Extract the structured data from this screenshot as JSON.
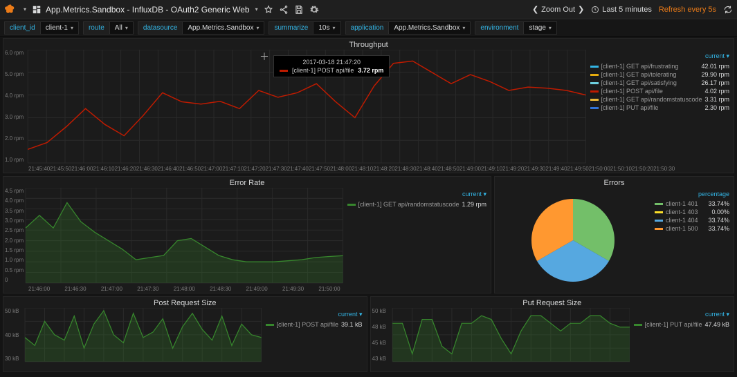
{
  "topbar": {
    "title": "App.Metrics.Sandbox - InfluxDB - OAuth2 Generic Web",
    "zoom_out": "Zoom Out",
    "timerange": "Last 5 minutes",
    "refresh": "Refresh every 5s"
  },
  "vars": [
    {
      "label": "client_id",
      "value": "client-1"
    },
    {
      "label": "route",
      "value": "All"
    },
    {
      "label": "datasource",
      "value": "App.Metrics.Sandbox"
    },
    {
      "label": "summarize",
      "value": "10s"
    },
    {
      "label": "application",
      "value": "App.Metrics.Sandbox"
    },
    {
      "label": "environment",
      "value": "stage"
    }
  ],
  "panels": {
    "throughput": {
      "title": "Throughput",
      "legend_header": "current",
      "tooltip": {
        "time": "2017-03-18 21:47:20",
        "series": "[client-1] POST api/file",
        "value": "3.72 rpm",
        "color": "#bf1b00"
      },
      "legend": [
        {
          "color": "#33b5e5",
          "name": "[client-1] GET api/frustrating",
          "value": "42.01 rpm"
        },
        {
          "color": "#e5ac0e",
          "name": "[client-1] GET api/tolerating",
          "value": "29.90 rpm"
        },
        {
          "color": "#6ed0e0",
          "name": "[client-1] GET api/satisfying",
          "value": "26.17 rpm"
        },
        {
          "color": "#bf1b00",
          "name": "[client-1] POST api/file",
          "value": "4.02 rpm"
        },
        {
          "color": "#eab839",
          "name": "[client-1] GET api/randomstatuscode",
          "value": "3.31 rpm"
        },
        {
          "color": "#3274d9",
          "name": "[client-1] PUT api/file",
          "value": "2.30 rpm"
        }
      ]
    },
    "errorrate": {
      "title": "Error Rate",
      "legend_header": "current",
      "legend": [
        {
          "color": "#37872d",
          "name": "[client-1] GET api/randomstatuscode",
          "value": "1.29 rpm"
        }
      ]
    },
    "errors": {
      "title": "Errors",
      "legend_header": "percentage",
      "legend": [
        {
          "color": "#73bf69",
          "name": "client-1 401",
          "value": "33.74%"
        },
        {
          "color": "#fade2a",
          "name": "client-1 403",
          "value": "0.00%"
        },
        {
          "color": "#56a8e0",
          "name": "client-1 404",
          "value": "33.74%"
        },
        {
          "color": "#ff9830",
          "name": "client-1 500",
          "value": "33.74%"
        }
      ]
    },
    "post": {
      "title": "Post Request Size",
      "legend_header": "current",
      "legend": [
        {
          "color": "#37872d",
          "name": "[client-1] POST api/file",
          "value": "39.1 kB"
        }
      ]
    },
    "put": {
      "title": "Put Request Size",
      "legend_header": "current",
      "legend": [
        {
          "color": "#37872d",
          "name": "[client-1] PUT api/file",
          "value": "47.49 kB"
        }
      ]
    }
  },
  "chart_data": [
    {
      "id": "throughput",
      "type": "line",
      "title": "Throughput",
      "ylabel": "",
      "ylim": [
        1,
        6
      ],
      "yunit": "rpm",
      "x": [
        "21:45:40",
        "21:45:50",
        "21:46:00",
        "21:46:10",
        "21:46:20",
        "21:46:30",
        "21:46:40",
        "21:46:50",
        "21:47:00",
        "21:47:10",
        "21:47:20",
        "21:47:30",
        "21:47:40",
        "21:47:50",
        "21:48:00",
        "21:48:10",
        "21:48:20",
        "21:48:30",
        "21:48:40",
        "21:48:50",
        "21:49:00",
        "21:49:10",
        "21:49:20",
        "21:49:30",
        "21:49:40",
        "21:49:50",
        "21:50:00",
        "21:50:10",
        "21:50:20",
        "21:50:30"
      ],
      "series": [
        {
          "name": "[client-1] POST api/file",
          "color": "#bf1b00",
          "values": [
            1.6,
            1.9,
            2.6,
            3.4,
            2.7,
            2.2,
            3.1,
            4.1,
            3.7,
            3.6,
            3.72,
            3.4,
            4.2,
            3.9,
            4.1,
            4.5,
            3.7,
            3.0,
            4.4,
            5.4,
            5.5,
            5.0,
            4.5,
            4.9,
            4.6,
            4.2,
            4.35,
            4.3,
            4.2,
            4.0
          ]
        }
      ]
    },
    {
      "id": "errorrate",
      "type": "line",
      "title": "Error Rate",
      "ylim": [
        0,
        4.5
      ],
      "yunit": "rpm",
      "x": [
        "21:46:00",
        "21:46:30",
        "21:47:00",
        "21:47:30",
        "21:48:00",
        "21:48:30",
        "21:49:00",
        "21:49:30",
        "21:50:00"
      ],
      "series": [
        {
          "name": "[client-1] GET api/randomstatuscode",
          "color": "#37872d",
          "values": [
            2.6,
            3.2,
            2.6,
            3.8,
            2.9,
            2.4,
            2.0,
            1.6,
            1.1,
            1.2,
            1.3,
            2.0,
            2.1,
            1.7,
            1.3,
            1.1,
            1.0,
            1.0,
            1.0,
            1.05,
            1.1,
            1.2,
            1.25,
            1.29
          ]
        }
      ]
    },
    {
      "id": "errors",
      "type": "pie",
      "title": "Errors",
      "slices": [
        {
          "name": "client-1 401",
          "value": 33.74,
          "color": "#73bf69"
        },
        {
          "name": "client-1 403",
          "value": 0.0,
          "color": "#fade2a"
        },
        {
          "name": "client-1 404",
          "value": 33.74,
          "color": "#56a8e0"
        },
        {
          "name": "client-1 500",
          "value": 33.74,
          "color": "#ff9830"
        }
      ]
    },
    {
      "id": "post_request_size",
      "type": "line",
      "title": "Post Request Size",
      "ylim": [
        30,
        50
      ],
      "yunit": "kB",
      "series": [
        {
          "name": "[client-1] POST api/file",
          "color": "#37872d",
          "values": [
            39,
            36,
            45,
            40,
            38,
            47,
            35,
            44,
            49,
            40,
            37,
            48,
            39,
            41,
            46,
            35,
            43,
            48,
            42,
            38,
            47,
            36,
            44,
            40,
            39
          ]
        }
      ]
    },
    {
      "id": "put_request_size",
      "type": "line",
      "title": "Put Request Size",
      "ylim": [
        43,
        50
      ],
      "yunit": "kB",
      "series": [
        {
          "name": "[client-1] PUT api/file",
          "color": "#37872d",
          "values": [
            48,
            48,
            44,
            48.5,
            48.5,
            45,
            44,
            48,
            48,
            49,
            48.5,
            46,
            44,
            47,
            49,
            49,
            48,
            47,
            48,
            48,
            49,
            49,
            48,
            47.5,
            47.5
          ]
        }
      ]
    }
  ]
}
